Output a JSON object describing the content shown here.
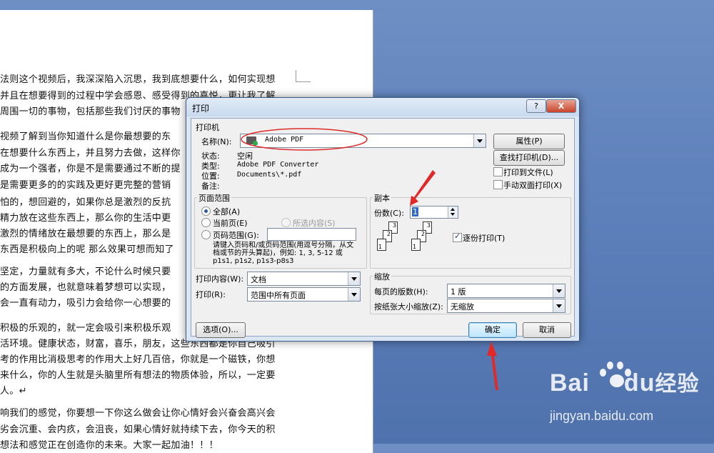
{
  "document": {
    "lines": [
      "法则这个视频后，我深深陷入沉思，我到底想要什么，如何实现想",
      "并且在想要得到的过程中学会感恩、感受得到的喜悦，更让我了解",
      "周围一切的事物，包括那些我们讨厌的事物",
      "视频了解到当你知道什么是你最想要的东",
      "在想要什么东西上，并且努力去做，这样你",
      "成为一个强者，你是不是需要通过不断的提",
      "是需要更多的的实践及更好更完整的营销",
      "怕的，想回避的，如果你总是激烈的反抗",
      "精力放在这些东西上，那么你的生活中更",
      "激烈的情绪放在最想要的东西上，那么是",
      "东西是积极向上的呢 那么效果可想而知了",
      "坚定，力量就有多大，不论什么时候只要",
      "的方面发展，也就意味着梦想可以实现，",
      "会一直有动力，吸引力会给你一心想要的",
      "积极的乐观的，就一定会吸引来积极乐观",
      "活环境。健康状态，财富，喜乐，朋友，这些东西都是你自己吸引",
      "考的作用比消极思考的作用大上好几百倍，你就是一个磁铁，你想",
      "来什么，你的人生就是头脑里所有想法的物质体验，所以，一定要",
      "人。↵",
      "响我们的感觉，你要想一下你这么做会让你心情好会兴奋会高兴会",
      "劣会沉重、会内疚，会沮丧，如果心情好就持续下去，你今天的积",
      "想法和感觉正在创造你的未来。大家一起加油！！！"
    ]
  },
  "watermark": {
    "logo": "Bai du经验",
    "url": "jingyan.baidu.com"
  },
  "dialog": {
    "title": "打印",
    "help_label": "?",
    "close_label": "X",
    "printer": {
      "group_label": "打印机",
      "name_label": "名称(N):",
      "name_value": "Adobe PDF",
      "status_label": "状态:",
      "status_value": "空闲",
      "type_label": "类型:",
      "type_value": "Adobe PDF Converter",
      "location_label": "位置:",
      "location_value": "Documents\\*.pdf",
      "comment_label": "备注:",
      "properties_button": "属性(P)",
      "find_printer_button": "查找打印机(D)...",
      "print_to_file": {
        "label": "打印到文件(L)",
        "checked": false
      },
      "manual_duplex": {
        "label": "手动双面打印(X)",
        "checked": false
      }
    },
    "page_range": {
      "group_label": "页面范围",
      "all": {
        "label": "全部(A)",
        "selected": true
      },
      "current": {
        "label": "当前页(E)",
        "selected": false
      },
      "selection": {
        "label": "所选内容(S)",
        "enabled": false
      },
      "pages": {
        "label": "页码范围(G):",
        "value": ""
      },
      "hint": "请键入页码和/或页码范围(用逗号分隔，从文档或节的开头算起)，例如: 1, 3, 5-12 或 p1s1, p1s2, p1s3-p8s3"
    },
    "copies": {
      "group_label": "副本",
      "count_label": "份数(C):",
      "count_value": "1",
      "collate_label": "逐份打印(T)",
      "collate_checked": true
    },
    "print_what": {
      "label": "打印内容(W):",
      "value": "文档"
    },
    "print": {
      "label": "打印(R):",
      "value": "范围中所有页面"
    },
    "zoom": {
      "group_label": "缩放",
      "pages_per_sheet_label": "每页的版数(H):",
      "pages_per_sheet_value": "1 版",
      "scale_label": "按纸张大小缩放(Z):",
      "scale_value": "无缩放"
    },
    "options_button": "选项(O)...",
    "ok_button": "确定",
    "cancel_button": "取消"
  },
  "colors": {
    "annotation": "#e02a2a",
    "desktop": "#5e80bb"
  }
}
